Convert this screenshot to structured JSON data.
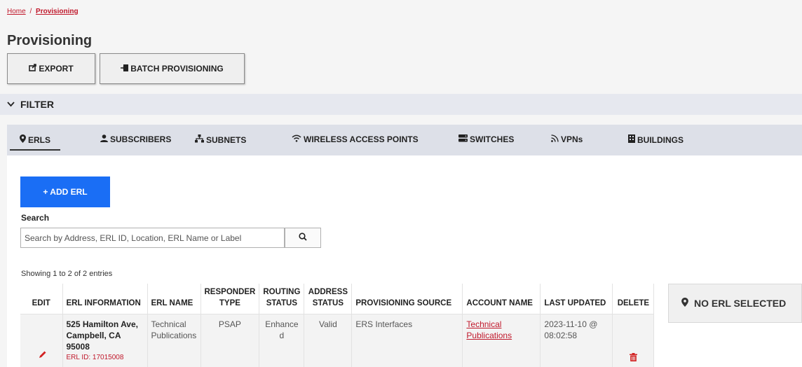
{
  "breadcrumb": {
    "home": "Home",
    "separator": "/",
    "current": "Provisioning"
  },
  "page": {
    "title": "Provisioning"
  },
  "toolbar": {
    "export_label": "EXPORT",
    "batch_label": "BATCH PROVISIONING"
  },
  "filter": {
    "label": "FILTER"
  },
  "tabs": [
    {
      "label": "ERLS",
      "icon": "map-pin-icon",
      "active": true
    },
    {
      "label": "SUBSCRIBERS",
      "icon": "user-icon"
    },
    {
      "label": "SUBNETS",
      "icon": "network-icon"
    },
    {
      "label": "WIRELESS ACCESS POINTS",
      "icon": "wifi-icon"
    },
    {
      "label": "SWITCHES",
      "icon": "server-icon"
    },
    {
      "label": "VPNs",
      "icon": "rss-icon"
    },
    {
      "label": "BUILDINGS",
      "icon": "building-icon"
    }
  ],
  "add_button": {
    "label": "+ ADD ERL"
  },
  "search": {
    "label": "Search",
    "placeholder": "Search by Address, ERL ID, Location, ERL Name or Label"
  },
  "entries_info": "Showing 1 to 2 of 2 entries",
  "table": {
    "headers": {
      "edit": "EDIT",
      "erl_info": "ERL INFORMATION",
      "erl_name": "ERL NAME",
      "responder_type": "RESPONDER TYPE",
      "routing_status": "ROUTING STATUS",
      "address_status": "ADDRESS STATUS",
      "provisioning_source": "PROVISIONING SOURCE",
      "account_name": "ACCOUNT NAME",
      "last_updated": "LAST UPDATED",
      "delete": "DELETE"
    },
    "rows": [
      {
        "erl_info": "525 Hamilton Ave, Campbell, CA 95008",
        "erl_id": "ERL ID: 17015008",
        "erl_name": "Technical Publications",
        "responder_type": "PSAP",
        "routing_status": "Enhanced",
        "address_status": "Valid",
        "provisioning_source": "ERS Interfaces",
        "account_name": "Technical Publications",
        "last_updated": "2023-11-10 @ 08:02:58"
      }
    ]
  },
  "side_panel": {
    "label": "NO ERL SELECTED"
  },
  "colors": {
    "accent": "#1a6ef5",
    "link": "#c0182b",
    "danger": "#d22222"
  }
}
